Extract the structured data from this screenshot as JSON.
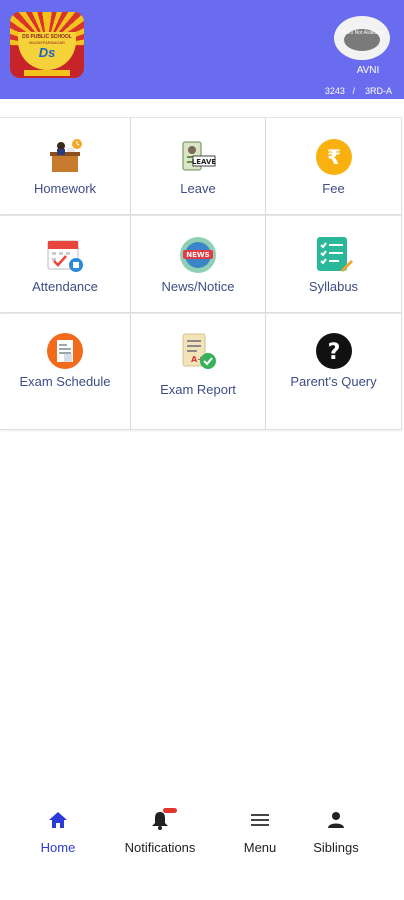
{
  "header": {
    "logo": {
      "line1": "DS PUBLIC SCHOOL",
      "line2": "MUZAFFARNAGAR",
      "monogram": "Ds"
    },
    "avatar_text": "Photo Not Available",
    "user_name": "AVNI",
    "admission_no": "3243",
    "separator": "/",
    "class_section": "3RD-A",
    "colors": {
      "header_bg": "#6a6cf0",
      "label_color": "#3e4c86",
      "active_nav": "#2a3bd8"
    }
  },
  "tiles": [
    {
      "label": "Homework",
      "icon": "teacher-desk-icon"
    },
    {
      "label": "Leave",
      "icon": "leave-card-icon"
    },
    {
      "label": "Fee",
      "icon": "rupee-coin-icon"
    },
    {
      "label": "Attendance",
      "icon": "calendar-check-icon"
    },
    {
      "label": "News/Notice",
      "icon": "news-globe-icon"
    },
    {
      "label": "Syllabus",
      "icon": "checklist-icon"
    },
    {
      "label": "Exam Schedule",
      "icon": "exam-schedule-icon"
    },
    {
      "label": "Exam Report",
      "icon": "report-card-icon"
    },
    {
      "label": "Parent's Query",
      "icon": "question-circle-icon"
    }
  ],
  "nav": {
    "items": [
      {
        "label": "Home",
        "icon": "home-icon",
        "active": true
      },
      {
        "label": "Notifications",
        "icon": "bell-icon",
        "active": false
      },
      {
        "label": "Menu",
        "icon": "hamburger-icon",
        "active": false
      },
      {
        "label": "Siblings",
        "icon": "person-icon",
        "active": false
      }
    ]
  }
}
